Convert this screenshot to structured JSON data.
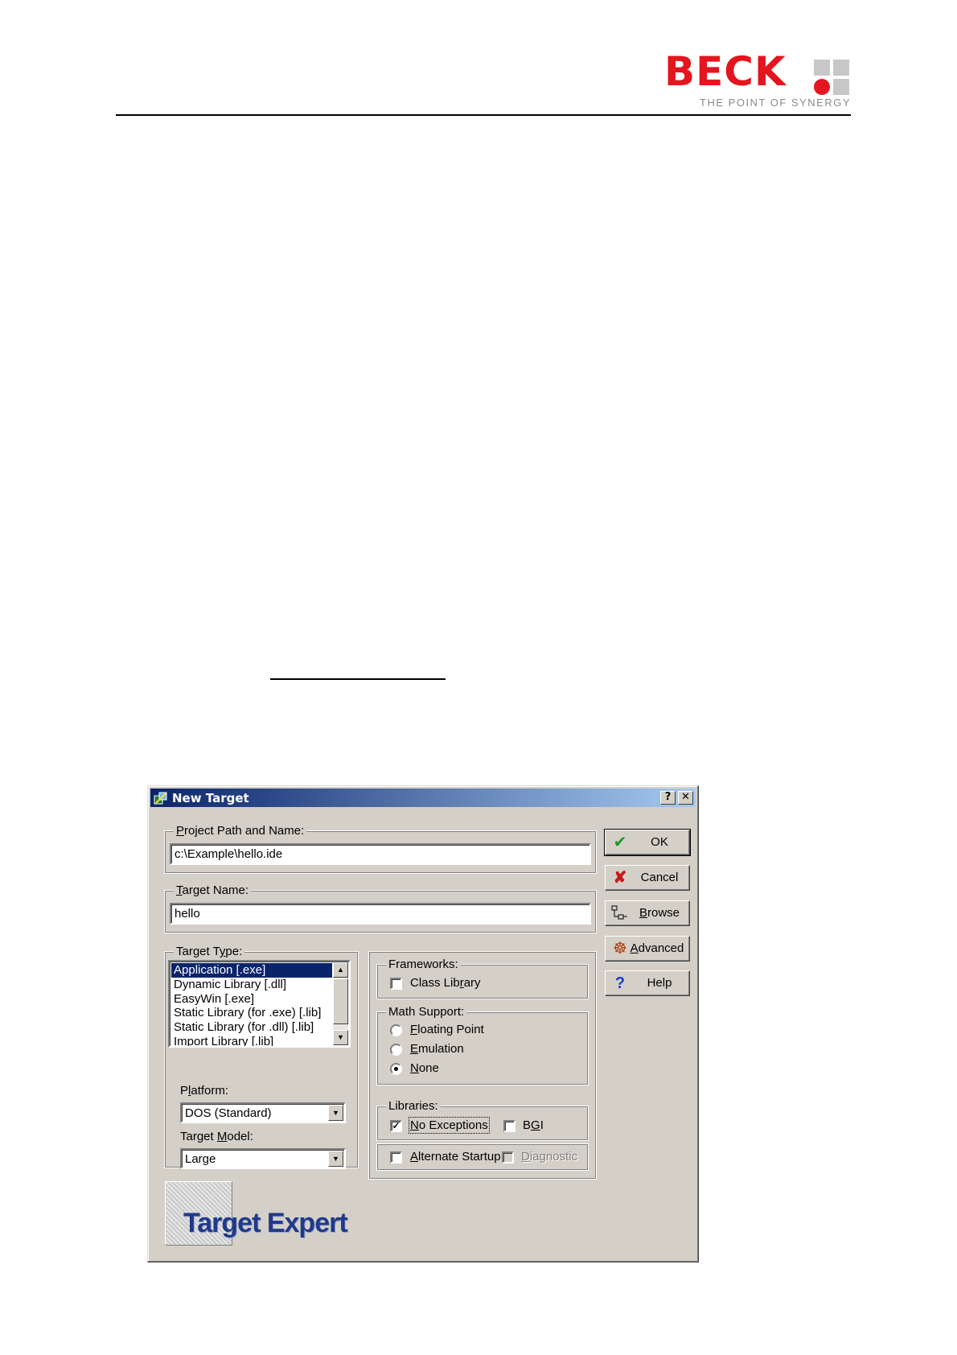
{
  "page": {
    "logo_text": "BECK",
    "logo_tagline": "THE POINT OF SYNERGY",
    "logo_colors": {
      "red": "#e3151f",
      "grey": "#c7c7c7"
    }
  },
  "dialog": {
    "title": "New Target",
    "help_button": "?",
    "close_button": "✕",
    "project_path": {
      "label_u": "P",
      "label_rest": "roject Path and Name:",
      "value": "c:\\Example\\hello.ide"
    },
    "target_name": {
      "label_u": "T",
      "label_rest": "arget Name:",
      "value": "hello"
    },
    "target_type": {
      "label_pre": "Target T",
      "label_u": "y",
      "label_rest": "pe:",
      "items": [
        "Application [.exe]",
        "Dynamic Library [.dll]",
        "EasyWin [.exe]",
        "Static Library (for .exe) [.lib]",
        "Static Library (for .dll) [.lib]",
        "Import Library [.lib]"
      ],
      "selected_index": 0
    },
    "platform": {
      "label_pre": "P",
      "label_u": "l",
      "label_rest": "atform:",
      "value": "DOS (Standard)"
    },
    "target_model": {
      "label_pre": "Target ",
      "label_u": "M",
      "label_rest": "odel:",
      "value": "Large"
    },
    "frameworks": {
      "label": "Frameworks:",
      "class_library": {
        "label_pre": "Class Lib",
        "label_u": "r",
        "label_rest": "ary",
        "checked": false
      }
    },
    "math_support": {
      "label": "Math Support:",
      "floating_point": {
        "label_u": "F",
        "label_rest": "loating Point",
        "selected": false
      },
      "emulation": {
        "label_u": "E",
        "label_rest": "mulation",
        "selected": false
      },
      "none": {
        "label_u": "N",
        "label_rest": "one",
        "selected": true
      }
    },
    "libraries": {
      "label": "Libraries:",
      "no_exceptions": {
        "label_u": "N",
        "label_rest": "o Exceptions",
        "checked": true
      },
      "bgi": {
        "label_pre": "B",
        "label_u": "G",
        "label_rest": "I",
        "checked": false
      },
      "alternate_startup": {
        "label_u": "A",
        "label_rest": "lternate Startup",
        "checked": false
      },
      "diagnostic": {
        "label_u": "D",
        "label_rest": "iagnostic",
        "checked": false,
        "enabled": false
      }
    },
    "buttons": {
      "ok": "OK",
      "cancel": "Cancel",
      "browse_u": "B",
      "browse_rest": "rowse",
      "advanced_u": "A",
      "advanced_rest": "dvanced",
      "help": "Help"
    },
    "expert_logo_text": "Target Expert",
    "colors": {
      "selection": "#0a246a",
      "face": "#d4d0c8",
      "expert_text": "#1f3a8a"
    }
  }
}
